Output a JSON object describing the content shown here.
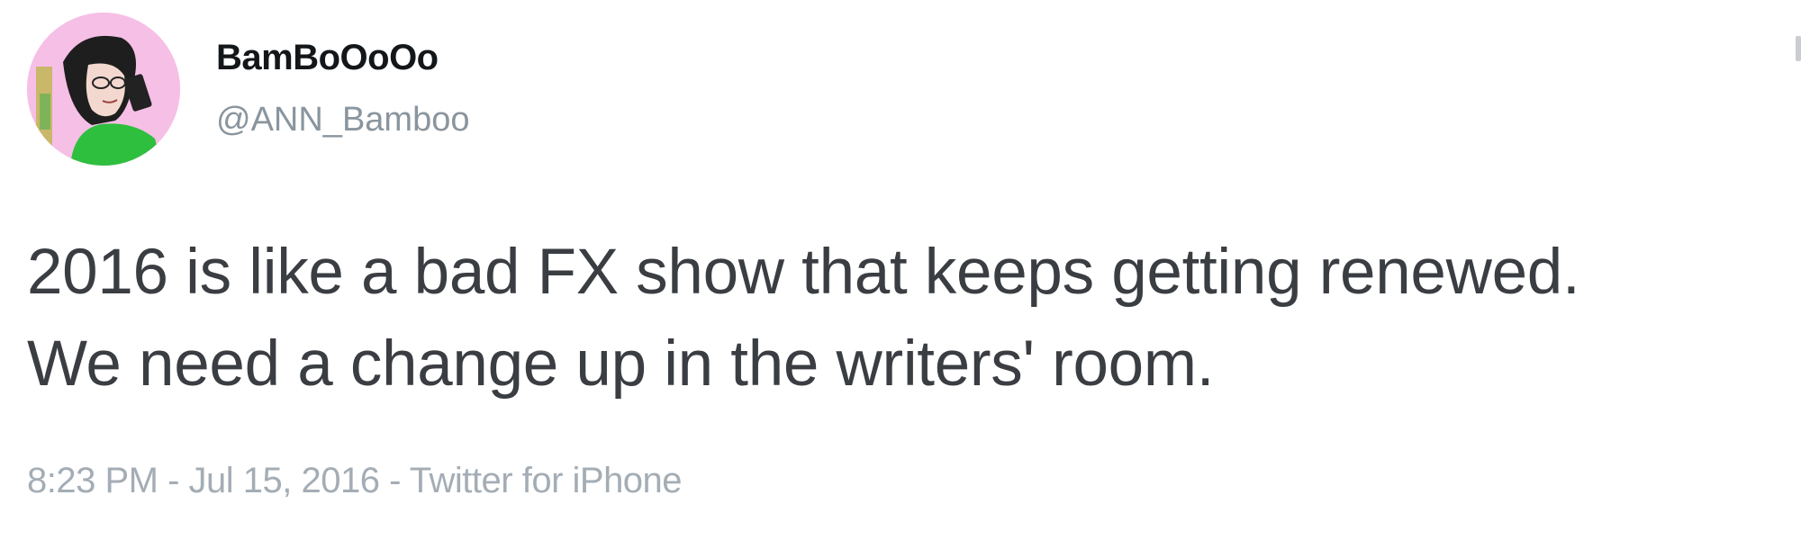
{
  "author": {
    "display_name": "BamBoOoOo",
    "handle": "@ANN_Bamboo",
    "avatar_icon": "avatar-cartoon-woman"
  },
  "tweet": {
    "text_lines": [
      "2016 is like a bad FX show that keeps getting renewed.",
      "We need a change up in the writers' room."
    ],
    "time": "8:23 PM",
    "separator": " - ",
    "date": "Jul 15, 2016",
    "source": "Twitter for iPhone"
  },
  "colors": {
    "name": "#14171a",
    "secondary": "#8a959e",
    "body": "#3a3d42",
    "avatar_bg": "#f6bfe6",
    "avatar_shirt": "#2fbf3f"
  }
}
